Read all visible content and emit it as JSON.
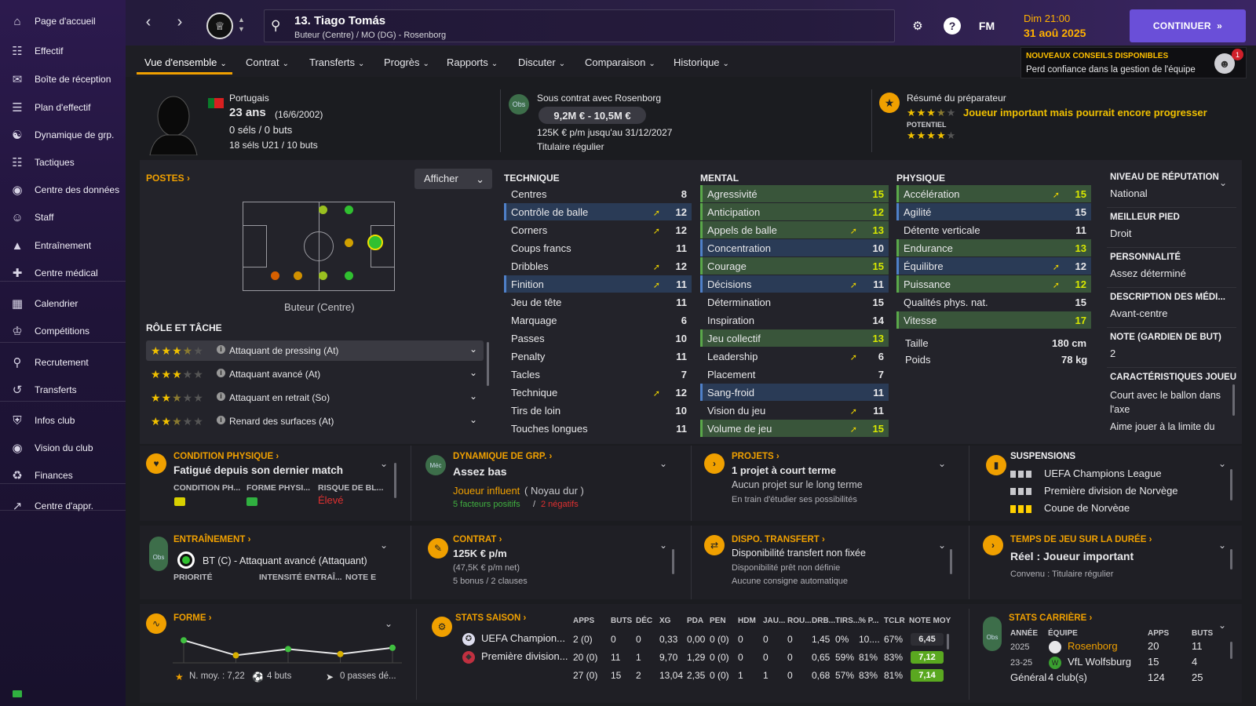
{
  "sidebar": {
    "items": [
      {
        "label": "Page d'accueil",
        "icon": "home-icon"
      },
      {
        "label": "Effectif",
        "icon": "shirt-icon"
      },
      {
        "label": "Boîte de réception",
        "icon": "inbox-icon"
      },
      {
        "label": "Plan d'effectif",
        "icon": "clipboard-icon"
      },
      {
        "label": "Dynamique de grp.",
        "icon": "group-icon"
      },
      {
        "label": "Tactiques",
        "icon": "tactics-icon"
      },
      {
        "label": "Centre des données",
        "icon": "data-icon"
      },
      {
        "label": "Staff",
        "icon": "staff-icon"
      },
      {
        "label": "Entraînement",
        "icon": "training-icon"
      },
      {
        "label": "Centre médical",
        "icon": "medical-icon"
      },
      {
        "label": "Calendrier",
        "icon": "calendar-icon"
      },
      {
        "label": "Compétitions",
        "icon": "trophy-icon"
      },
      {
        "label": "Recrutement",
        "icon": "scout-icon"
      },
      {
        "label": "Transferts",
        "icon": "transfer-icon"
      },
      {
        "label": "Infos club",
        "icon": "shield-icon"
      },
      {
        "label": "Vision du club",
        "icon": "vision-icon"
      },
      {
        "label": "Finances",
        "icon": "finance-icon"
      },
      {
        "label": "Centre d'appr.",
        "icon": "learning-icon"
      }
    ]
  },
  "topbar": {
    "player_title": "13. Tiago Tomás",
    "player_sub": "Buteur (Centre) / MO (DG) - Rosenborg",
    "fm_label": "FM",
    "time": "Dim 21:00",
    "date": "31 aoû 2025",
    "continue_label": "CONTINUER"
  },
  "tabs": [
    "Vue d'ensemble",
    "Contrat",
    "Transferts",
    "Progrès",
    "Rapports",
    "Discuter",
    "Comparaison",
    "Historique"
  ],
  "advice": {
    "title": "NOUVEAUX CONSEILS DISPONIBLES",
    "text": "Perd confiance dans la gestion de l'équipe",
    "count": "1"
  },
  "profile": {
    "nationality": "Portugais",
    "age": "23 ans",
    "dob": "(16/6/2002)",
    "caps": "0 séls / 0 buts",
    "u21": "18 séls U21 / 10 buts",
    "contract_title": "Sous contrat avec Rosenborg",
    "obs_badge": "Obs",
    "value": "9,2M € - 10,5M €",
    "wage_line": "125K € p/m jusqu'au 31/12/2027",
    "status": "Titulaire régulier",
    "coach_title": "Résumé du préparateur",
    "coach_text": "Joueur important mais pourrait encore progresser",
    "potential_label": "POTENTIEL",
    "ability_stars": 3.5,
    "potential_stars": 4
  },
  "positions": {
    "title": "POSTES",
    "show_label": "Afficher",
    "position_label": "Buteur (Centre)",
    "role_title": "RÔLE ET TÂCHE",
    "roles": [
      {
        "label": "Attaquant de pressing (At)",
        "stars": 3.5
      },
      {
        "label": "Attaquant avancé (At)",
        "stars": 3
      },
      {
        "label": "Attaquant en retrait (So)",
        "stars": 2.5
      },
      {
        "label": "Renard des surfaces (At)",
        "stars": 2.5
      }
    ]
  },
  "technique": {
    "title": "TECHNIQUE",
    "attrs": [
      {
        "name": "Centres",
        "value": "8",
        "arrow": false,
        "hl": ""
      },
      {
        "name": "Contrôle de balle",
        "value": "12",
        "arrow": true,
        "hl": "blue"
      },
      {
        "name": "Corners",
        "value": "12",
        "arrow": true,
        "hl": ""
      },
      {
        "name": "Coups francs",
        "value": "11",
        "arrow": false,
        "hl": ""
      },
      {
        "name": "Dribbles",
        "value": "12",
        "arrow": true,
        "hl": ""
      },
      {
        "name": "Finition",
        "value": "11",
        "arrow": true,
        "hl": "blue"
      },
      {
        "name": "Jeu de tête",
        "value": "11",
        "arrow": false,
        "hl": ""
      },
      {
        "name": "Marquage",
        "value": "6",
        "arrow": false,
        "hl": ""
      },
      {
        "name": "Passes",
        "value": "10",
        "arrow": false,
        "hl": ""
      },
      {
        "name": "Penalty",
        "value": "11",
        "arrow": false,
        "hl": ""
      },
      {
        "name": "Tacles",
        "value": "7",
        "arrow": false,
        "hl": ""
      },
      {
        "name": "Technique",
        "value": "12",
        "arrow": true,
        "hl": ""
      },
      {
        "name": "Tirs de loin",
        "value": "10",
        "arrow": false,
        "hl": ""
      },
      {
        "name": "Touches longues",
        "value": "11",
        "arrow": false,
        "hl": ""
      }
    ]
  },
  "mental": {
    "title": "MENTAL",
    "attrs": [
      {
        "name": "Agressivité",
        "value": "15",
        "arrow": false,
        "hl": "green"
      },
      {
        "name": "Anticipation",
        "value": "12",
        "arrow": false,
        "hl": "green"
      },
      {
        "name": "Appels de balle",
        "value": "13",
        "arrow": true,
        "hl": "green"
      },
      {
        "name": "Concentration",
        "value": "10",
        "arrow": false,
        "hl": "blue"
      },
      {
        "name": "Courage",
        "value": "15",
        "arrow": false,
        "hl": "green"
      },
      {
        "name": "Décisions",
        "value": "11",
        "arrow": true,
        "hl": "blue"
      },
      {
        "name": "Détermination",
        "value": "15",
        "arrow": false,
        "hl": ""
      },
      {
        "name": "Inspiration",
        "value": "14",
        "arrow": false,
        "hl": ""
      },
      {
        "name": "Jeu collectif",
        "value": "13",
        "arrow": false,
        "hl": "green"
      },
      {
        "name": "Leadership",
        "value": "6",
        "arrow": true,
        "hl": ""
      },
      {
        "name": "Placement",
        "value": "7",
        "arrow": false,
        "hl": ""
      },
      {
        "name": "Sang-froid",
        "value": "11",
        "arrow": false,
        "hl": "blue"
      },
      {
        "name": "Vision du jeu",
        "value": "11",
        "arrow": true,
        "hl": ""
      },
      {
        "name": "Volume de jeu",
        "value": "15",
        "arrow": true,
        "hl": "green"
      }
    ]
  },
  "physique": {
    "title": "PHYSIQUE",
    "attrs": [
      {
        "name": "Accélération",
        "value": "15",
        "arrow": true,
        "hl": "green"
      },
      {
        "name": "Agilité",
        "value": "15",
        "arrow": false,
        "hl": "blue"
      },
      {
        "name": "Détente verticale",
        "value": "11",
        "arrow": false,
        "hl": ""
      },
      {
        "name": "Endurance",
        "value": "13",
        "arrow": false,
        "hl": "green"
      },
      {
        "name": "Équilibre",
        "value": "12",
        "arrow": true,
        "hl": "blue"
      },
      {
        "name": "Puissance",
        "value": "12",
        "arrow": true,
        "hl": "green"
      },
      {
        "name": "Qualités phys. nat.",
        "value": "15",
        "arrow": false,
        "hl": ""
      },
      {
        "name": "Vitesse",
        "value": "17",
        "arrow": false,
        "hl": "green"
      }
    ],
    "height_label": "Taille",
    "height": "180 cm",
    "weight_label": "Poids",
    "weight": "78 kg"
  },
  "info": {
    "items": [
      {
        "title": "NIVEAU DE RÉPUTATION",
        "value": "National"
      },
      {
        "title": "MEILLEUR PIED",
        "value": "Droit"
      },
      {
        "title": "PERSONNALITÉ",
        "value": "Assez déterminé"
      },
      {
        "title": "DESCRIPTION DES MÉDI...",
        "value": "Avant-centre"
      },
      {
        "title": "NOTE (GARDIEN DE BUT)",
        "value": "2"
      }
    ],
    "traits_title": "CARACTÉRISTIQUES JOUEU",
    "trait1a": "Court avec le ballon dans",
    "trait1b": "l'axe",
    "trait2": "Aime jouer à la limite du"
  },
  "cards": {
    "condition": {
      "title": "CONDITION PHYSIQUE",
      "text": "Fatigué depuis son dernier match",
      "c1": "CONDITION PH...",
      "c2": "FORME PHYSI...",
      "c3": "RISQUE DE BL...",
      "risk": "Élevé"
    },
    "dynamics": {
      "title": "DYNAMIQUE DE GRP.",
      "badge": "Méc",
      "text": "Assez bas",
      "influence": "Joueur influent",
      "core": "( Noyau dur )",
      "pos": "5 facteurs positifs",
      "sep": "/",
      "neg": "2 négatifs"
    },
    "projects": {
      "title": "PROJETS",
      "text": "1 projet à court terme",
      "line2": "Aucun projet sur le long terme",
      "line3": "En train d'étudier ses possibilités"
    },
    "suspensions": {
      "title": "SUSPENSIONS",
      "items": [
        "UEFA Champions League",
        "Première division de Norvège",
        "Coupe de Norvège"
      ]
    },
    "training": {
      "title": "ENTRAÎNEMENT",
      "badge": "Obs",
      "text": "BT (C) - Attaquant avancé (Attaquant)",
      "c1": "PRIORITÉ",
      "c2": "INTENSITÉ ENTRAÎ...",
      "c3": "NOTE E"
    },
    "contract": {
      "title": "CONTRAT",
      "text": "125K € p/m",
      "line2": "(47,5K € p/m net)",
      "line3": "5 bonus / 2 clauses"
    },
    "transfer": {
      "title": "DISPO. TRANSFERT",
      "text": "Disponibilité transfert non fixée",
      "line2": "Disponibilité prêt non définie",
      "line3": "Aucune consigne automatique"
    },
    "playtime": {
      "title": "TEMPS DE JEU SUR LA DURÉE",
      "text": "Réel : Joueur important",
      "line2": "Convenu : Titulaire régulier"
    }
  },
  "form": {
    "title": "FORME",
    "avg": "N. moy. : 7,22",
    "goals": "4 buts",
    "assists": "0 passes dé...",
    "points": [
      7.8,
      6.6,
      7.1,
      6.7,
      7.2
    ]
  },
  "season": {
    "title": "STATS SAISON",
    "headers": [
      "APPS",
      "BUTS",
      "DÉC",
      "XG",
      "PDA",
      "PEN",
      "HDM",
      "JAU...",
      "ROU...",
      "DRB...",
      "TIRS...",
      "% P...",
      "TCLR",
      "NOTE MOY"
    ],
    "rows": [
      {
        "comp": "UEFA Champion...",
        "vals": [
          "2 (0)",
          "0",
          "0",
          "0,33",
          "0,00",
          "0 (0)",
          "0",
          "0",
          "0",
          "1,45",
          "0%",
          "10....",
          "67%",
          "6,45"
        ]
      },
      {
        "comp": "Première division...",
        "vals": [
          "20 (0)",
          "11",
          "1",
          "9,70",
          "1,29",
          "0 (0)",
          "0",
          "0",
          "0",
          "0,65",
          "59%",
          "81%",
          "83%",
          "7,12"
        ]
      },
      {
        "comp": "",
        "vals": [
          "27 (0)",
          "15",
          "2",
          "13,04",
          "2,35",
          "0 (0)",
          "1",
          "1",
          "0",
          "0,68",
          "57%",
          "83%",
          "81%",
          "7,14"
        ]
      }
    ]
  },
  "career": {
    "title": "STATS CARRIÈRE",
    "badge": "Obs",
    "headers": [
      "ANNÉE",
      "ÉQUIPE",
      "APPS",
      "BUTS"
    ],
    "rows": [
      {
        "year": "2025",
        "team": "Rosenborg",
        "apps": "20",
        "goals": "11"
      },
      {
        "year": "23-25",
        "team": "VfL Wolfsburg",
        "apps": "15",
        "goals": "4"
      }
    ],
    "total_label": "Général",
    "total_clubs": "4 club(s)",
    "total_apps": "124",
    "total_goals": "25"
  },
  "colors": {
    "accent": "#f0a000",
    "purple": "#6a4fd8",
    "green": "#3a5a38",
    "blue": "#2b3a54"
  }
}
